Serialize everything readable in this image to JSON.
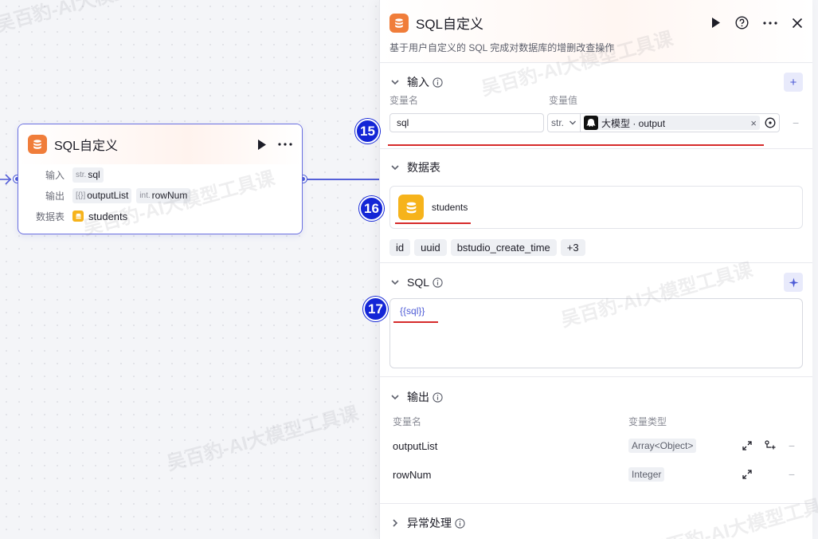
{
  "watermark": "吴百豹-AI大模型工具课",
  "node": {
    "title": "SQL自定义",
    "input_label": "输入",
    "input_type": "str.",
    "input_name": "sql",
    "output_label": "输出",
    "output1_type": "[{}]",
    "output1_name": "outputList",
    "output2_type": "int.",
    "output2_name": "rowNum",
    "table_label": "数据表",
    "table_name": "students"
  },
  "panel": {
    "title": "SQL自定义",
    "description": "基于用户自定义的 SQL 完成对数据库的增删改查操作",
    "input_section": {
      "title": "输入",
      "col_name": "变量名",
      "col_value": "变量值",
      "var_name": "sql",
      "var_type": "str.",
      "ref_value": "大模型 · output",
      "ref_clear": "×",
      "remove": "−",
      "add": "+"
    },
    "table_section": {
      "title": "数据表",
      "table_name": "students",
      "fields": [
        "id",
        "uuid",
        "bstudio_create_time",
        "+3"
      ]
    },
    "sql_section": {
      "title": "SQL",
      "code": "{{sql}}"
    },
    "output_section": {
      "title": "输出",
      "col_name": "变量名",
      "col_type": "变量类型",
      "rows": [
        {
          "name": "outputList",
          "type": "Array<Object>"
        },
        {
          "name": "rowNum",
          "type": "Integer"
        }
      ],
      "remove": "−"
    },
    "exception_section": {
      "title": "异常处理"
    }
  },
  "markers": [
    "15",
    "16",
    "17"
  ],
  "colors": {
    "accent": "#4d5bd6",
    "marker": "#1426d6",
    "db_orange": "#f07d3a",
    "db_yellow": "#f6b31b",
    "underline_red": "#d62b2b"
  }
}
